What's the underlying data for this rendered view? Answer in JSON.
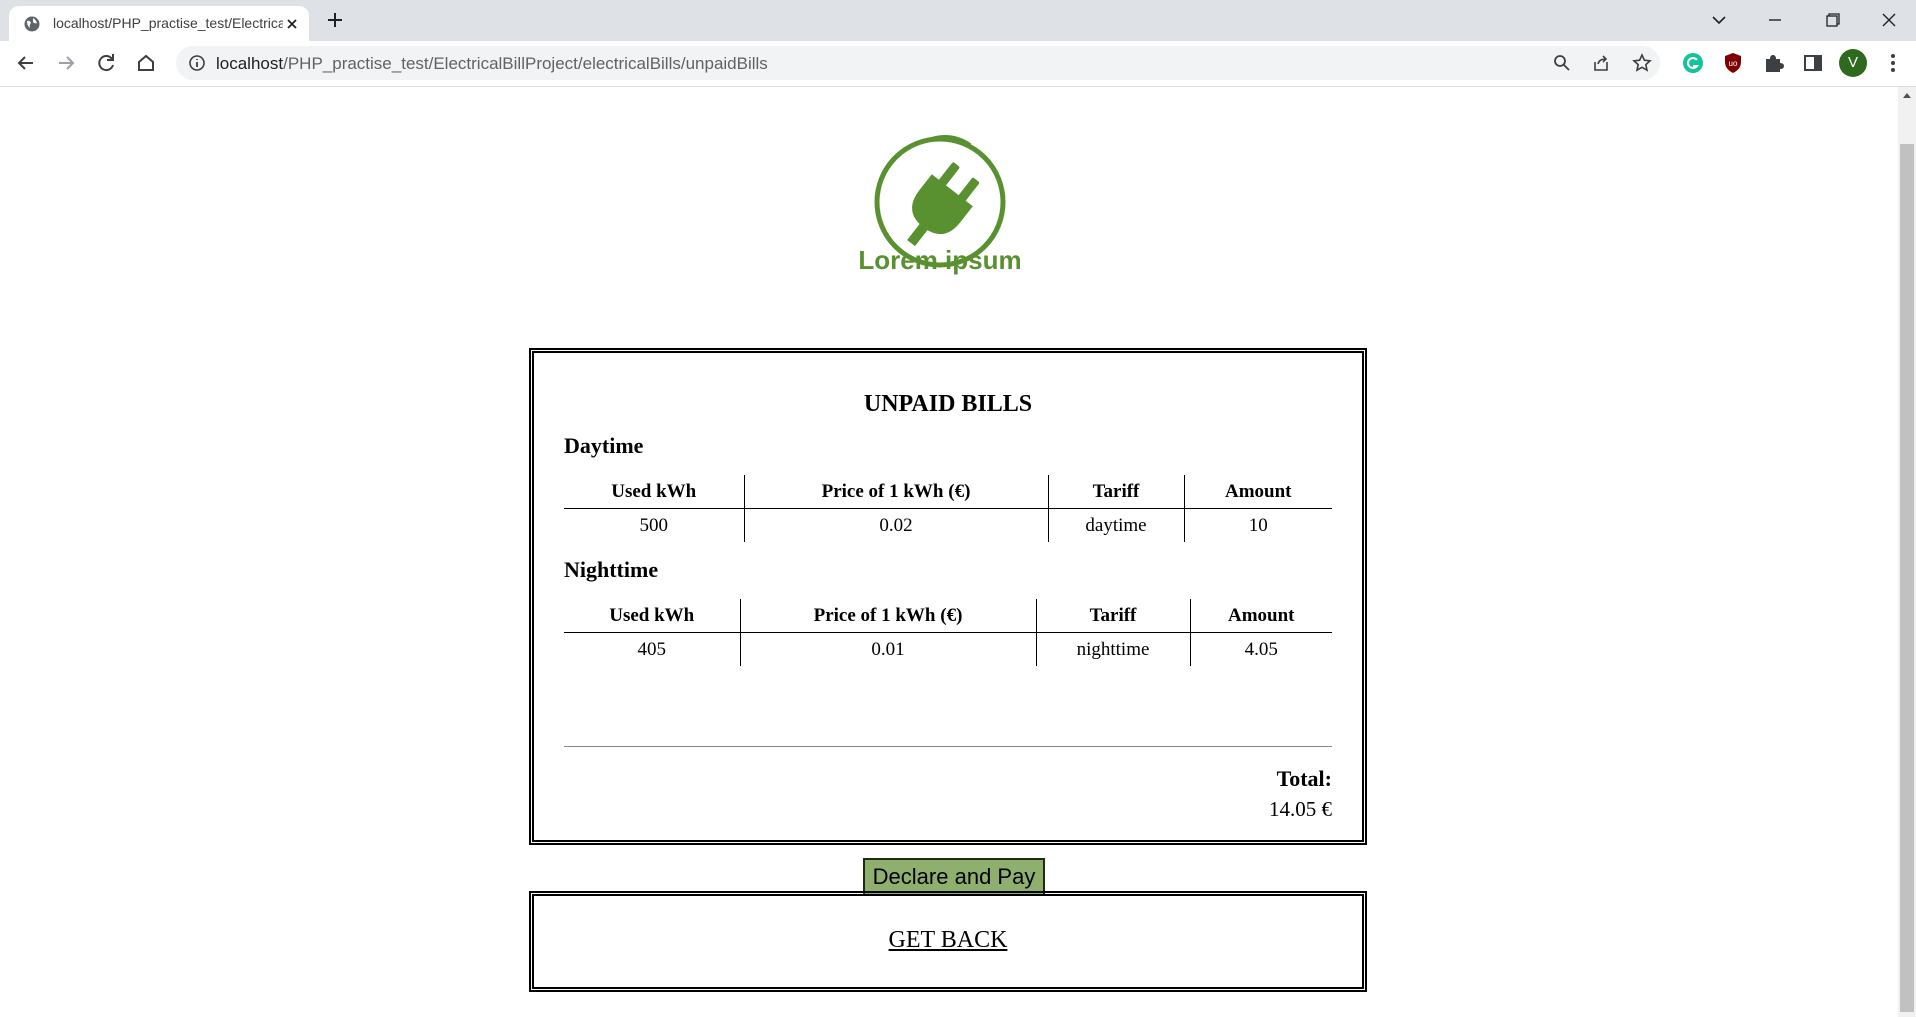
{
  "browser": {
    "tab_title": "localhost/PHP_practise_test/ElectricalBillProject/electricalBills/unpaidBills",
    "url_host": "localhost",
    "url_path": "/PHP_practise_test/ElectricalBillProject/electricalBills/unpaidBills",
    "profile_initial": "V"
  },
  "logo": {
    "text": "Lorem ipsum",
    "color": "#5a9130"
  },
  "bills": {
    "title": "UNPAID BILLS",
    "daytime": {
      "heading": "Daytime",
      "columns": [
        "Used kWh",
        "Price of 1 kWh (€)",
        "Tariff",
        "Amount"
      ],
      "row": [
        "500",
        "0.02",
        "daytime",
        "10"
      ]
    },
    "nighttime": {
      "heading": "Nighttime",
      "columns": [
        "Used kWh",
        "Price of 1 kWh (€)",
        "Tariff",
        "Amount"
      ],
      "row": [
        "405",
        "0.01",
        "nighttime",
        "4.05"
      ]
    },
    "total_label": "Total:",
    "total_value": "14.05 €",
    "pay_button": "Declare and Pay"
  },
  "back_link": "GET BACK",
  "colors": {
    "button_bg": "#8faf6f",
    "accent": "#5a9130"
  }
}
